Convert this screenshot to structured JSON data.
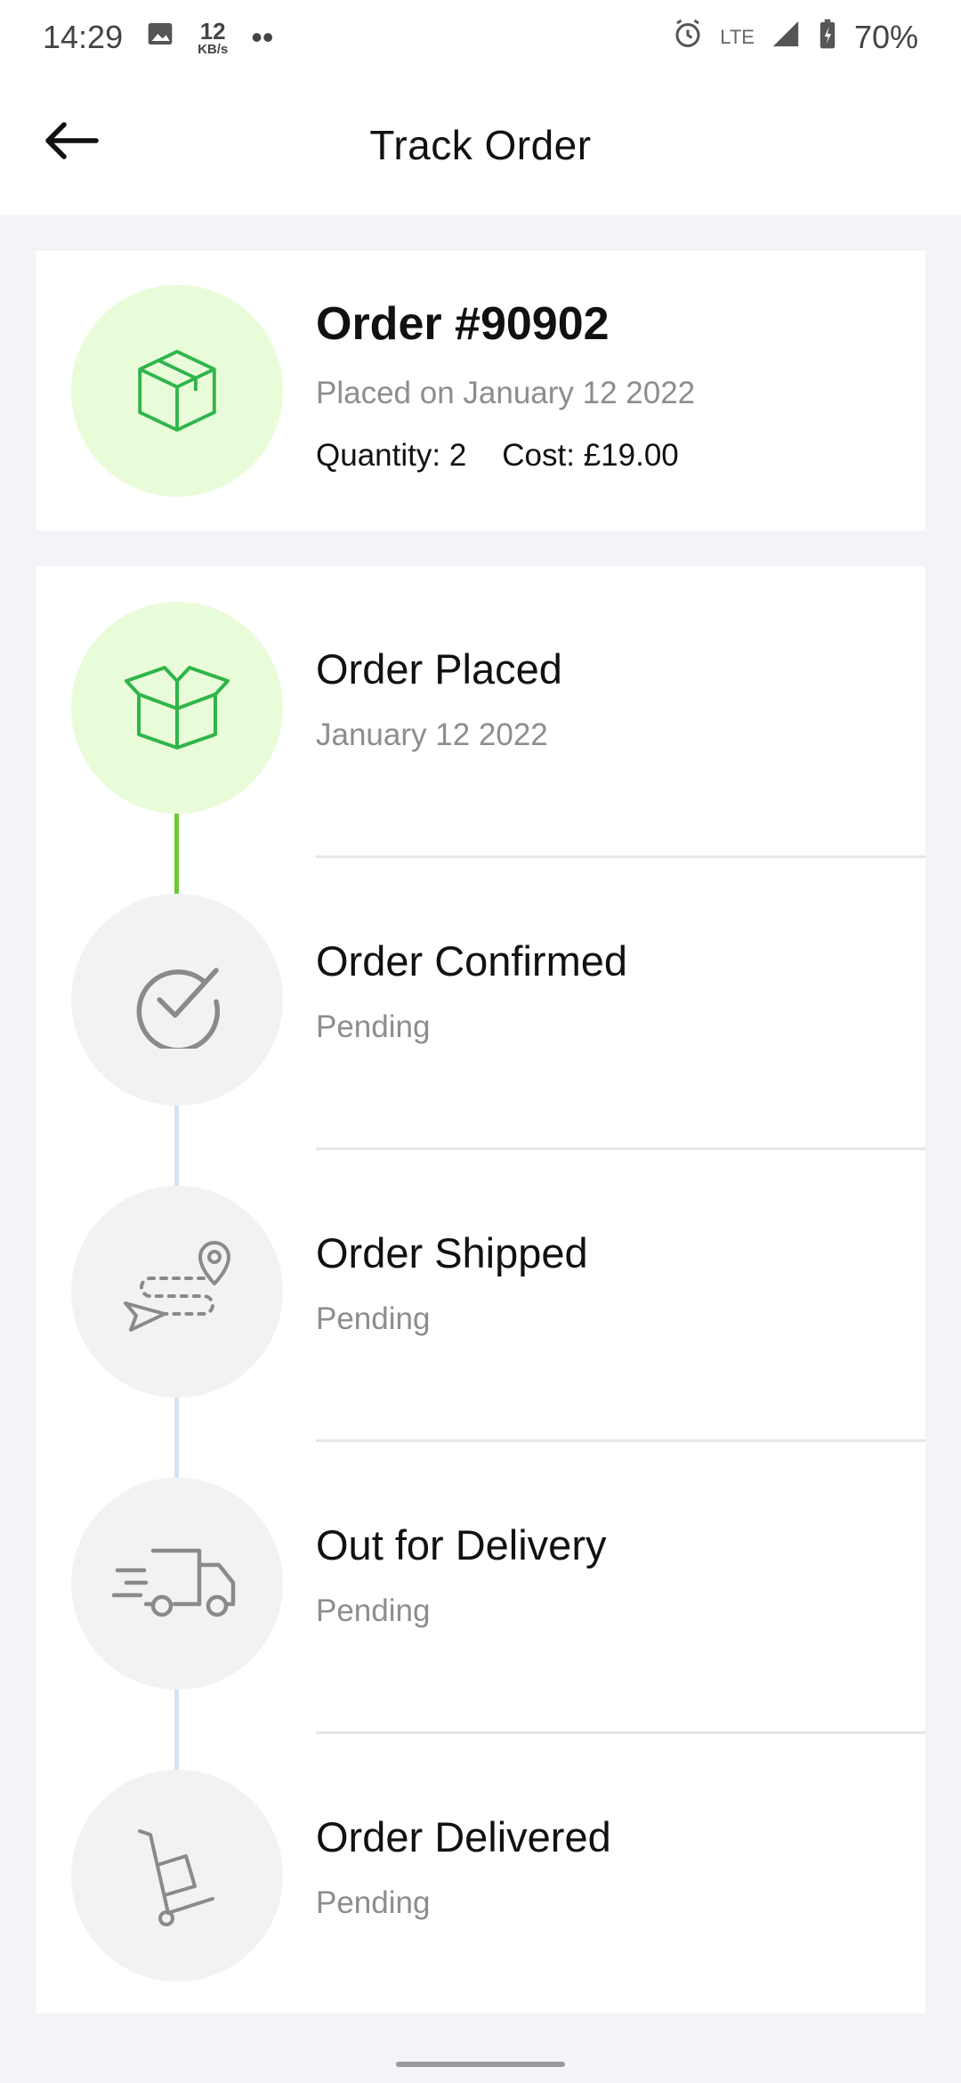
{
  "status_bar": {
    "time": "14:29",
    "net_speed_value": "12",
    "net_speed_unit": "KB/s",
    "dots": "••",
    "network": "LTE",
    "battery": "70%"
  },
  "header": {
    "title": "Track Order"
  },
  "order": {
    "title": "Order #90902",
    "placed_on": "Placed on January 12 2022",
    "quantity_label": "Quantity:",
    "quantity_value": "2",
    "cost_label": "Cost:",
    "cost_value": "£19.00"
  },
  "steps": [
    {
      "title": "Order Placed",
      "sub": "January 12 2022",
      "state": "done",
      "icon": "open-box-icon"
    },
    {
      "title": "Order Confirmed",
      "sub": "Pending",
      "state": "pending",
      "icon": "check-circle-icon"
    },
    {
      "title": "Order Shipped",
      "sub": "Pending",
      "state": "pending",
      "icon": "route-pin-icon"
    },
    {
      "title": "Out for Delivery",
      "sub": "Pending",
      "state": "pending",
      "icon": "delivery-truck-icon"
    },
    {
      "title": "Order Delivered",
      "sub": "Pending",
      "state": "pending",
      "icon": "hand-truck-icon"
    }
  ],
  "colors": {
    "active_icon": "#2fb54a",
    "active_circle": "#e9fcd9",
    "pending_icon": "#8a8a8a",
    "pending_circle": "#f2f2f2",
    "connector_done": "#6cc934",
    "connector_todo": "#d3e5f5"
  }
}
